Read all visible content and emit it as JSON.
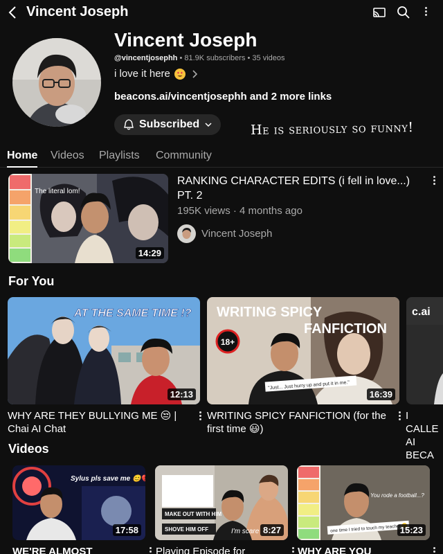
{
  "header": {
    "title": "Vincent Joseph",
    "icons": [
      "back-icon",
      "cast-icon",
      "search-icon",
      "more-icon"
    ]
  },
  "channel": {
    "name": "Vincent Joseph",
    "handle": "@vincentjosephh",
    "subscribers": "81.9K subscribers",
    "videos": "35 videos",
    "separator": "•",
    "bio": "i love it here",
    "links": "beacons.ai/vincentjosephh and 2 more links",
    "subscribe_label": "Subscribed"
  },
  "annotation": "He is seriously so funny!",
  "tabs": [
    {
      "label": "Home",
      "active": true
    },
    {
      "label": "Videos",
      "active": false
    },
    {
      "label": "Playlists",
      "active": false
    },
    {
      "label": "Community",
      "active": false
    }
  ],
  "featured": {
    "title": "RANKING CHARACTER EDITS (i fell in love...) PT. 2",
    "meta": "195K views · 4 months ago",
    "channel": "Vincent Joseph",
    "duration": "14:29",
    "thumb_caption": "The literal lom!"
  },
  "sections": {
    "for_you": "For You",
    "videos": "Videos"
  },
  "for_you": [
    {
      "title": "WHY ARE THEY BULLYING ME 😒 | Chai AI Chat",
      "duration": "12:13",
      "thumb_text": "AT THE SAME TIME !?"
    },
    {
      "title": "WRITING SPICY FANFICTION (for the first time 😃)",
      "duration": "16:39",
      "thumb_text_1": "WRITING SPICY",
      "thumb_text_2": "FANFICTION",
      "badge": "18+",
      "caption": "\"Just... Just hurry up and put it in me.\""
    },
    {
      "title": "I CALLE AI BECA",
      "thumb_text": "c.ai"
    }
  ],
  "videos": [
    {
      "title": "WE'RE ALMOST",
      "duration": "17:58",
      "thumb_text": "Sylus pls save me 😊💔"
    },
    {
      "title": "Playing Episode for",
      "duration": "8:27",
      "thumb_text_1": "MAKE OUT WITH HIM",
      "thumb_text_2": "SHOVE HIM OFF",
      "thumb_text_3": "I'm scare"
    },
    {
      "title": "WHY ARE YOU",
      "duration": "15:23",
      "thumb_text_1": "You rode a football...?",
      "thumb_text_2": "one time I tried to touch my teacher 🫣"
    }
  ],
  "colors": {
    "background": "#0f0f0f",
    "button": "#272727",
    "muted_text": "#aaaaaa"
  }
}
